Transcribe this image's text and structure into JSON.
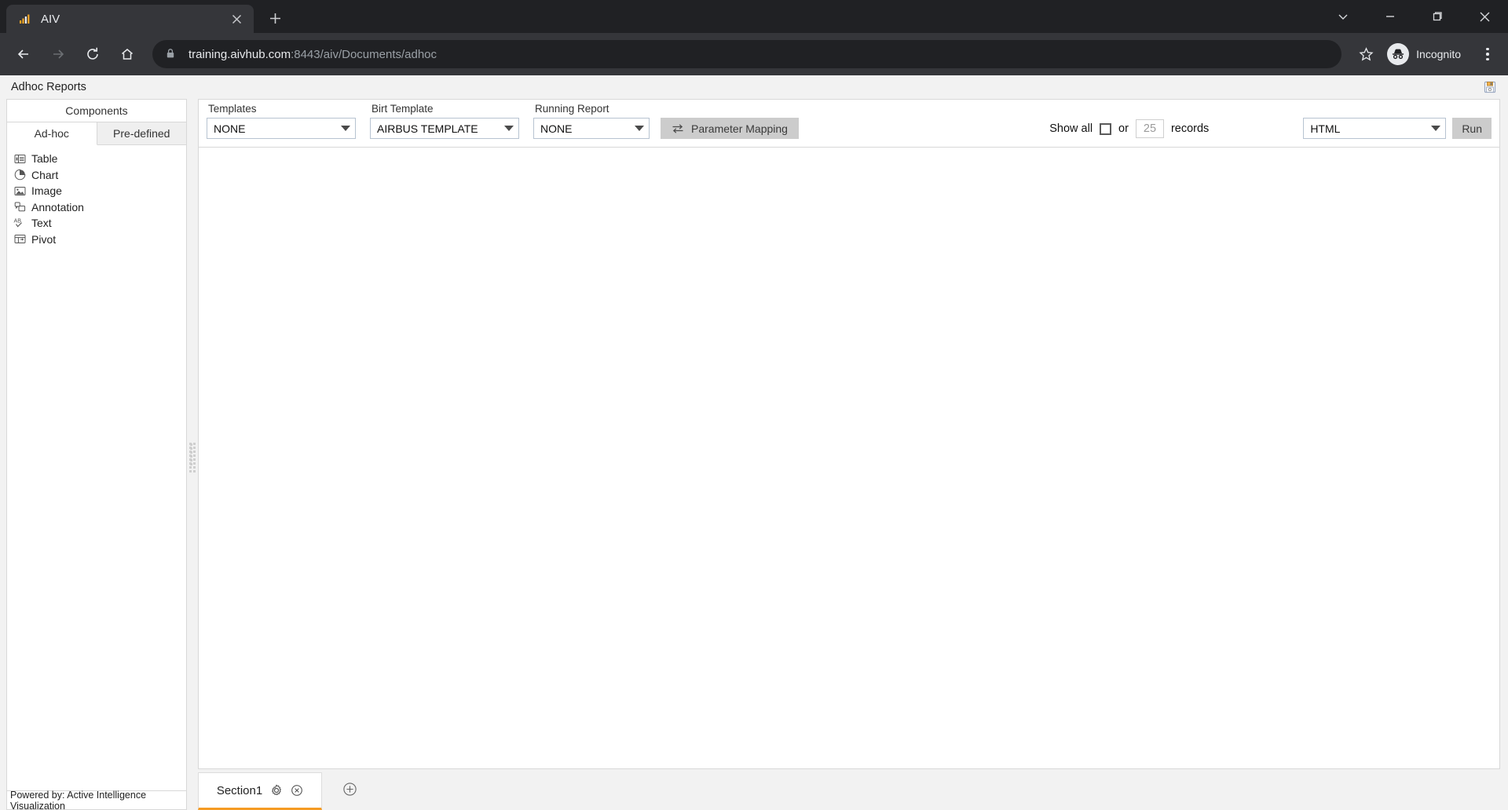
{
  "browser": {
    "tab": {
      "title": "AIV",
      "favicon_icon": "aiv-bars-icon",
      "close_icon": "close-icon"
    },
    "new_tab_icon": "plus-icon",
    "window_controls": [
      {
        "name": "minimize-to-tray",
        "icon": "chevron-down-icon"
      },
      {
        "name": "minimize",
        "icon": "minimize-icon"
      },
      {
        "name": "maximize",
        "icon": "maximize-icon"
      },
      {
        "name": "close",
        "icon": "close-icon"
      }
    ],
    "nav": {
      "back_icon": "arrow-left-icon",
      "forward_icon": "arrow-right-icon",
      "reload_icon": "reload-icon",
      "home_icon": "home-icon"
    },
    "omnibox": {
      "lock_icon": "lock-icon",
      "url_host": "training.aivhub.com",
      "url_rest": ":8443/aiv/Documents/adhoc",
      "bookmark_icon": "star-icon"
    },
    "profile": {
      "label": "Incognito",
      "icon": "incognito-icon"
    },
    "menu_icon": "kebab-menu-icon"
  },
  "app": {
    "title": "Adhoc Reports",
    "save_icon": "save-floppy-icon",
    "footer": "Powered by: Active Intelligence Visualization"
  },
  "components": {
    "header": "Components",
    "tabs": [
      {
        "label": "Ad-hoc",
        "active": true
      },
      {
        "label": "Pre-defined",
        "active": false
      }
    ],
    "items": [
      {
        "label": "Table",
        "icon": "table-icon"
      },
      {
        "label": "Chart",
        "icon": "pie-chart-icon"
      },
      {
        "label": "Image",
        "icon": "image-icon"
      },
      {
        "label": "Annotation",
        "icon": "annotation-icon"
      },
      {
        "label": "Text",
        "icon": "text-ab-icon"
      },
      {
        "label": "Pivot",
        "icon": "pivot-table-icon"
      }
    ]
  },
  "toolbar": {
    "templates": {
      "label": "Templates",
      "value": "NONE"
    },
    "birt_template": {
      "label": "Birt Template",
      "value": "AIRBUS TEMPLATE"
    },
    "running_report": {
      "label": "Running Report",
      "value": "NONE"
    },
    "parameter_mapping": {
      "label": "Parameter Mapping",
      "icon": "swap-arrows-icon"
    },
    "show_all": {
      "label": "Show all",
      "checked": false
    },
    "or_label": "or",
    "records_value": "25",
    "records_label": "records",
    "output_format": {
      "value": "HTML"
    },
    "run": {
      "label": "Run"
    }
  },
  "sections": {
    "tabs": [
      {
        "label": "Section1",
        "settings_icon": "gear-icon",
        "close_icon": "close-circle-icon",
        "active": true
      }
    ],
    "add_icon": "plus-circle-icon"
  },
  "colors": {
    "accent": "#f59b23",
    "chrome_dark": "#202124",
    "chrome_toolbar": "#35363a",
    "page_bg": "#f2f2f2",
    "button_grey": "#cccccc"
  }
}
